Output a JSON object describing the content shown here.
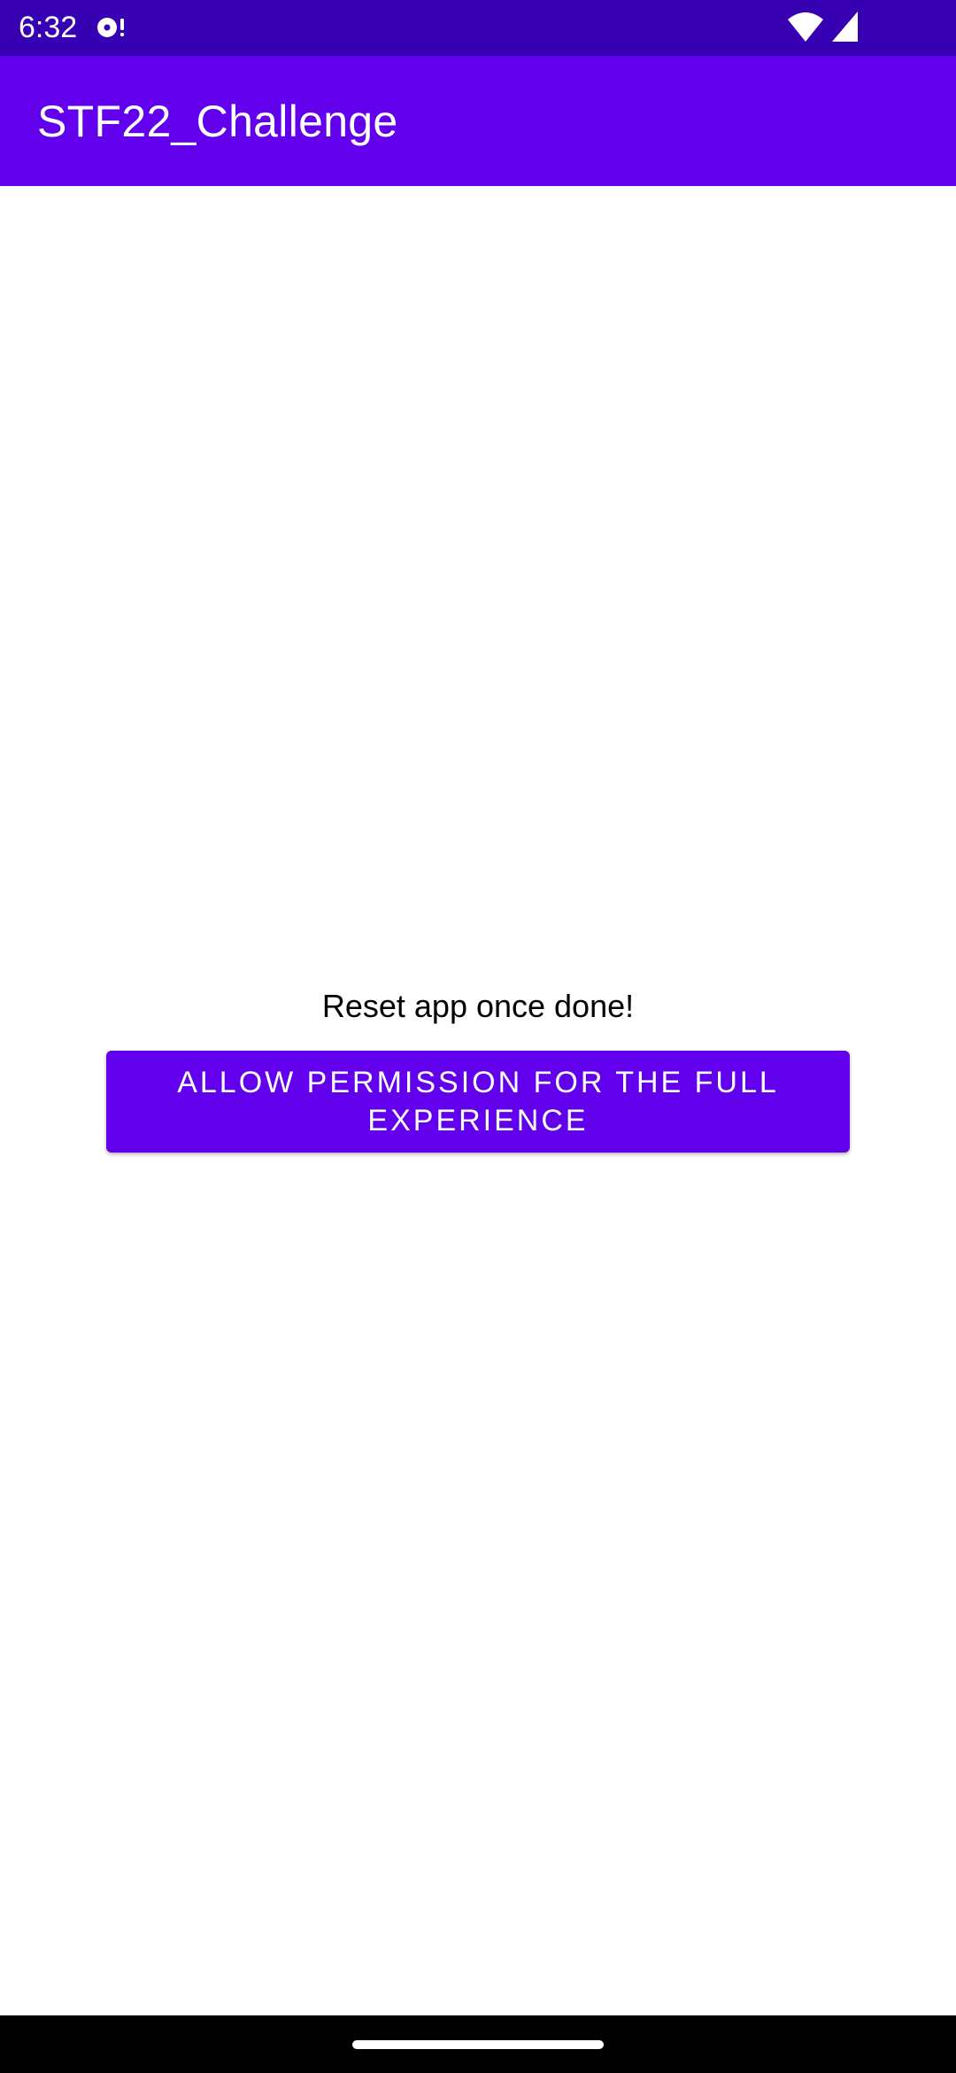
{
  "status_bar": {
    "time": "6:32",
    "background_color": "#3700B3",
    "icons": [
      "notification-icon",
      "wifi-icon",
      "signal-icon"
    ]
  },
  "app_bar": {
    "title": "STF22_Challenge",
    "background_color": "#6200EE"
  },
  "main": {
    "message": "Reset app once done!",
    "permission_button_label": "ALLOW PERMISSION FOR THE FULL EXPERIENCE",
    "button_color": "#6200EE"
  },
  "nav_bar": {
    "background_color": "#000000",
    "icons": [
      "home-handle"
    ]
  }
}
